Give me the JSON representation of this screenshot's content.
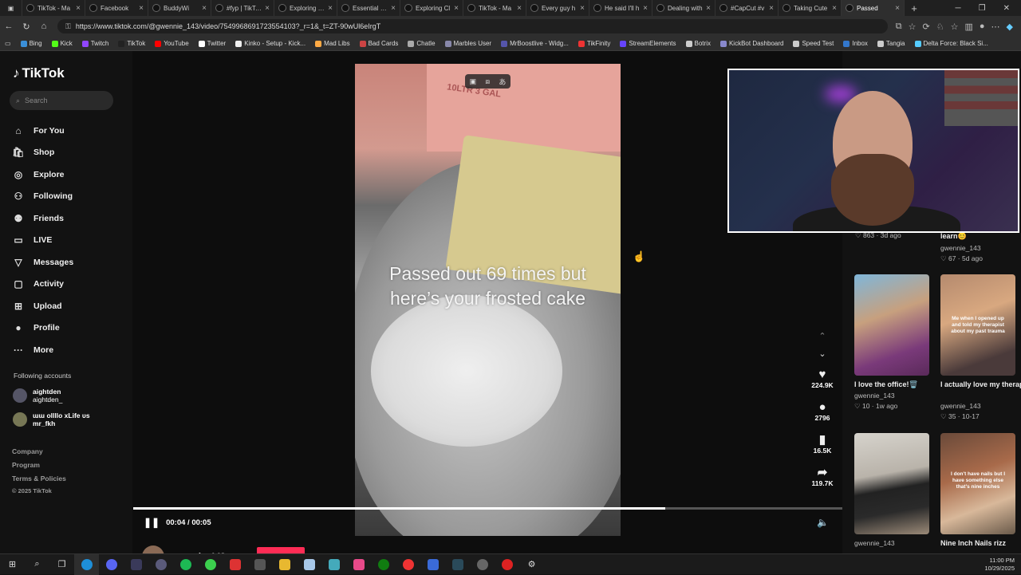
{
  "browser": {
    "tabs": [
      {
        "label": "TikTok - Ma"
      },
      {
        "label": "Facebook"
      },
      {
        "label": "BuddyWi"
      },
      {
        "label": "#fyp | TikTok"
      },
      {
        "label": "Exploring Sh"
      },
      {
        "label": "Essential Co"
      },
      {
        "label": "Exploring Cl"
      },
      {
        "label": "TikTok - Ma"
      },
      {
        "label": "Every guy h"
      },
      {
        "label": "He said I'll h"
      },
      {
        "label": "Dealing with"
      },
      {
        "label": "#CapCut #v"
      },
      {
        "label": "Taking Cute"
      },
      {
        "label": "Passed"
      }
    ],
    "new_tab": "+",
    "url": "https://www.tiktok.com/@gwennie_143/video/7549968691723554103?_r=1&_t=ZT-90wUl6eIrgT",
    "bookmarks": [
      {
        "label": "Bing"
      },
      {
        "label": "Kick"
      },
      {
        "label": "Twitch"
      },
      {
        "label": "TikTok"
      },
      {
        "label": "YouTube"
      },
      {
        "label": "Twitter"
      },
      {
        "label": "Kinko - Setup - Kick..."
      },
      {
        "label": "Mad Libs"
      },
      {
        "label": "Bad Cards"
      },
      {
        "label": "Chatle"
      },
      {
        "label": "Marbles User"
      },
      {
        "label": "MrBoostlive - Widg..."
      },
      {
        "label": "TikFinity"
      },
      {
        "label": "StreamElements"
      },
      {
        "label": "Botrix"
      },
      {
        "label": "KickBot Dashboard"
      },
      {
        "label": "Speed Test"
      },
      {
        "label": "Inbox"
      },
      {
        "label": "Tangia"
      },
      {
        "label": "Delta Force: Black Si..."
      }
    ]
  },
  "sidebar": {
    "logo": "TikTok",
    "search_placeholder": "Search",
    "nav": [
      {
        "label": "For You",
        "icon": "home-icon",
        "glyph": "⌂"
      },
      {
        "label": "Shop",
        "icon": "shop-icon",
        "glyph": "🛍"
      },
      {
        "label": "Explore",
        "icon": "explore-icon",
        "glyph": "◎"
      },
      {
        "label": "Following",
        "icon": "following-icon",
        "glyph": "⚇"
      },
      {
        "label": "Friends",
        "icon": "friends-icon",
        "glyph": "⚉"
      },
      {
        "label": "LIVE",
        "icon": "live-icon",
        "glyph": "▭"
      },
      {
        "label": "Messages",
        "icon": "messages-icon",
        "glyph": "▽"
      },
      {
        "label": "Activity",
        "icon": "activity-icon",
        "glyph": "▢"
      },
      {
        "label": "Upload",
        "icon": "upload-icon",
        "glyph": "⊞"
      },
      {
        "label": "Profile",
        "icon": "profile-icon",
        "glyph": "●"
      },
      {
        "label": "More",
        "icon": "more-icon",
        "glyph": "···"
      }
    ],
    "following_heading": "Following accounts",
    "following": [
      {
        "name": "aightden",
        "handle": "aightden_"
      },
      {
        "name": "ɯɯ ollllo xLife ᴜs",
        "handle": "mr_fkh"
      }
    ],
    "footer": [
      "Company",
      "Program",
      "Terms & Policies"
    ],
    "copyright": "© 2025 TikTok"
  },
  "video": {
    "caption": "Passed out 69 times but here’s your frosted cake",
    "jug_text": "10LTR    3 GAL",
    "time": "00:04 / 00:05",
    "progress": 0.75,
    "likes": "224.9K",
    "comments": "2796",
    "saves": "16.5K",
    "shares": "119.7K",
    "author": "gwennie_143"
  },
  "right_panel": {
    "top_left_stats": "♡ 863 · 3d ago",
    "top_right_title": "learn😊",
    "top_right_user": "gwennie_143",
    "top_right_stats": "♡ 67 · 5d ago",
    "thumbs": [
      {
        "title": "I love the office!🗑️",
        "user": "gwennie_143",
        "stats": "♡ 10 · 1w ago",
        "overlay": ""
      },
      {
        "title": "I actually love my therapist tho😊",
        "user": "gwennie_143",
        "stats": "♡ 35 · 10-17",
        "overlay": "Me when I opened up and told my therapist about my past trauma"
      },
      {
        "title": "",
        "user": "gwennie_143",
        "stats": "",
        "overlay": ""
      },
      {
        "title": "Nine Inch Nails rizz",
        "user": "",
        "stats": "",
        "overlay": "I don't have nails but I have something else that's nine inches"
      }
    ]
  },
  "taskbar": {
    "time": "11:00 PM",
    "date": "10/29/2025"
  },
  "colors": {
    "accent": "#fe2c55",
    "background": "#121212"
  }
}
